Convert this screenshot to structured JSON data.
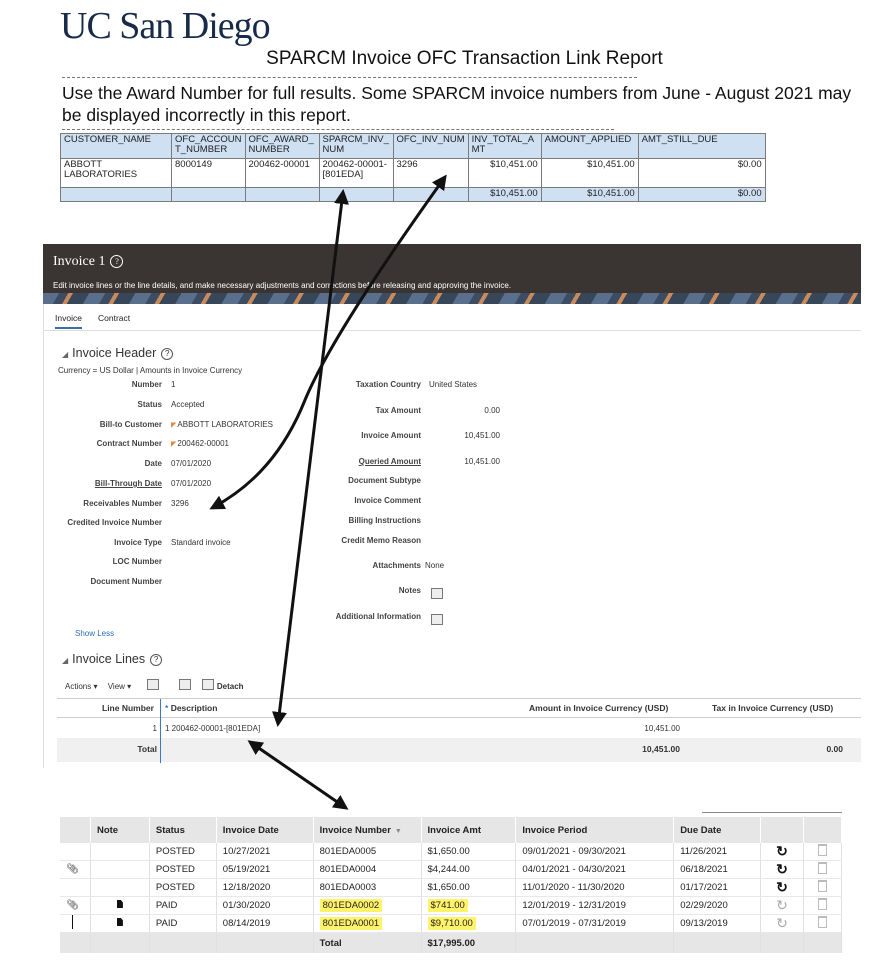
{
  "logo": "UC San Diego",
  "report": {
    "title": "SPARCM Invoice OFC Transaction Link Report",
    "notice": "Use the Award Number for full results. Some SPARCM invoice numbers from June - August 2021 may be displayed incorrectly in this report.",
    "columns": [
      "CUSTOMER_NAME",
      "OFC_ACCOUNT_NUMBER",
      "OFC_AWARD_NUMBER",
      "SPARCM_INV_NUM",
      "OFC_INV_NUM",
      "INV_TOTAL_AMT",
      "AMOUNT_APPLIED",
      "AMT_STILL_DUE"
    ],
    "row": {
      "customer": "ABBOTT LABORATORIES",
      "account": "8000149",
      "award": "200462-00001",
      "sparcm_inv": "200462-00001-[801EDA]",
      "ofc_inv": "3296",
      "inv_total": "$10,451.00",
      "applied": "$10,451.00",
      "still_due": "$0.00"
    },
    "totals": {
      "inv_total": "$10,451.00",
      "applied": "$10,451.00",
      "still_due": "$0.00"
    }
  },
  "invoice": {
    "title": "Invoice 1",
    "subtitle": "Edit invoice lines or the line details, and make necessary adjustments and corrections before releasing and approving the invoice.",
    "tabs": [
      "Invoice",
      "Contract"
    ],
    "header_section": "Invoice Header",
    "currency_note": "Currency = US Dollar | Amounts in Invoice Currency",
    "left_fields": [
      {
        "label": "Number",
        "value": "1"
      },
      {
        "label": "Status",
        "value": "Accepted"
      },
      {
        "label": "Bill-to Customer",
        "value": "ABBOTT LABORATORIES"
      },
      {
        "label": "Contract Number",
        "value": "200462-00001"
      },
      {
        "label": "Date",
        "value": "07/01/2020"
      },
      {
        "label": "Bill-Through Date",
        "value": "07/01/2020"
      },
      {
        "label": "Receivables Number",
        "value": "3296"
      },
      {
        "label": "Credited Invoice Number",
        "value": ""
      },
      {
        "label": "Invoice Type",
        "value": "Standard invoice"
      },
      {
        "label": "LOC Number",
        "value": ""
      },
      {
        "label": "Document Number",
        "value": ""
      }
    ],
    "right_fields": [
      {
        "label": "Taxation Country",
        "value": "United States"
      },
      {
        "label": "Tax Amount",
        "value": "0.00"
      },
      {
        "label": "Invoice Amount",
        "value": "10,451.00"
      },
      {
        "label": "Queried Amount",
        "value": "10,451.00"
      },
      {
        "label": "Document Subtype",
        "value": ""
      },
      {
        "label": "Invoice Comment",
        "value": ""
      },
      {
        "label": "Billing Instructions",
        "value": ""
      },
      {
        "label": "Credit Memo Reason",
        "value": ""
      },
      {
        "label": "Attachments",
        "value": "None"
      },
      {
        "label": "Notes",
        "value": ""
      },
      {
        "label": "Additional Information",
        "value": ""
      }
    ],
    "show_less": "Show Less",
    "lines_section": "Invoice Lines",
    "toolbar": {
      "actions": "Actions",
      "view": "View",
      "detach": "Detach"
    },
    "lines_columns": {
      "line_number": "Line Number",
      "description": "Description",
      "amount": "Amount in Invoice Currency (USD)",
      "tax": "Tax in Invoice Currency (USD)"
    },
    "line": {
      "number": "1",
      "description": "1 200462-00001-[801EDA]",
      "amount": "10,451.00"
    },
    "total": {
      "label": "Total",
      "amount": "10,451.00",
      "tax": "0.00"
    }
  },
  "invoice_list": {
    "columns": [
      "Note",
      "Status",
      "Invoice Date",
      "Invoice Number",
      "Invoice Amt",
      "Invoice Period",
      "Due Date"
    ],
    "rows": [
      {
        "clip": false,
        "doc": false,
        "status": "POSTED",
        "date": "10/27/2021",
        "number": "801EDA0005",
        "amt": "$1,650.00",
        "period": "09/01/2021 - 09/30/2021",
        "due": "11/26/2021",
        "highlight": false,
        "rotate_active": true
      },
      {
        "clip": true,
        "doc": false,
        "status": "POSTED",
        "date": "05/19/2021",
        "number": "801EDA0004",
        "amt": "$4,244.00",
        "period": "04/01/2021 - 04/30/2021",
        "due": "06/18/2021",
        "highlight": false,
        "rotate_active": true
      },
      {
        "clip": false,
        "doc": false,
        "status": "POSTED",
        "date": "12/18/2020",
        "number": "801EDA0003",
        "amt": "$1,650.00",
        "period": "11/01/2020 - 11/30/2020",
        "due": "01/17/2021",
        "highlight": false,
        "rotate_active": true
      },
      {
        "clip": true,
        "doc": true,
        "status": "PAID",
        "date": "01/30/2020",
        "number": "801EDA0002",
        "amt": "$741.00",
        "period": "12/01/2019 - 12/31/2019",
        "due": "02/29/2020",
        "highlight": true,
        "rotate_active": false
      },
      {
        "clip": false,
        "doc": true,
        "status": "PAID",
        "date": "08/14/2019",
        "number": "801EDA0001",
        "amt": "$9,710.00",
        "period": "07/01/2019 - 07/31/2019",
        "due": "09/13/2019",
        "highlight": true,
        "rotate_active": false
      }
    ],
    "total_label": "Total",
    "total_amt": "$17,995.00"
  }
}
